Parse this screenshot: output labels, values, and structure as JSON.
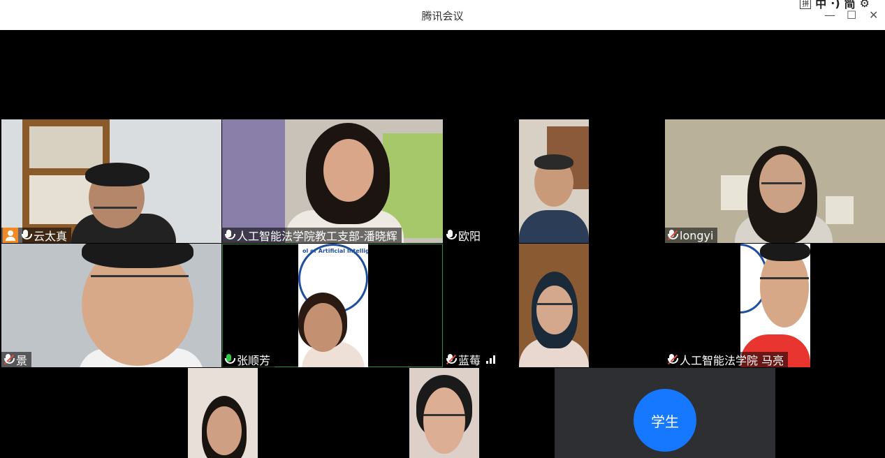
{
  "window": {
    "title": "腾讯会议",
    "controls": {
      "minimize": "—",
      "maximize": "☐",
      "close": "✕"
    }
  },
  "ime": {
    "pin": "拼",
    "mode": "中",
    "punct": "·)",
    "simp": "简"
  },
  "participants": [
    {
      "name": "云太真",
      "mic": "on",
      "host": true
    },
    {
      "name": "人工智能法学院教工支部-潘晓辉",
      "mic": "on"
    },
    {
      "name": "欧阳",
      "mic": "on"
    },
    {
      "name": "longyi",
      "mic": "muted"
    },
    {
      "name": "景",
      "mic": "muted"
    },
    {
      "name": "张顺芳",
      "mic": "speaking"
    },
    {
      "name": "蓝莓",
      "mic": "muted",
      "signal": "3-bars"
    },
    {
      "name": "人工智能法学院 马亮",
      "mic": "muted"
    },
    {
      "name": "",
      "mic": ""
    },
    {
      "name": "",
      "mic": ""
    },
    {
      "name": "学生",
      "avatar": true
    }
  ],
  "logo_text": "ol of Artificial Intellig",
  "colors": {
    "host_badge": "#f08a24",
    "avatar_bg": "#1677ff",
    "speaking": "#2ecc40",
    "muted_slash": "#e74c3c"
  }
}
